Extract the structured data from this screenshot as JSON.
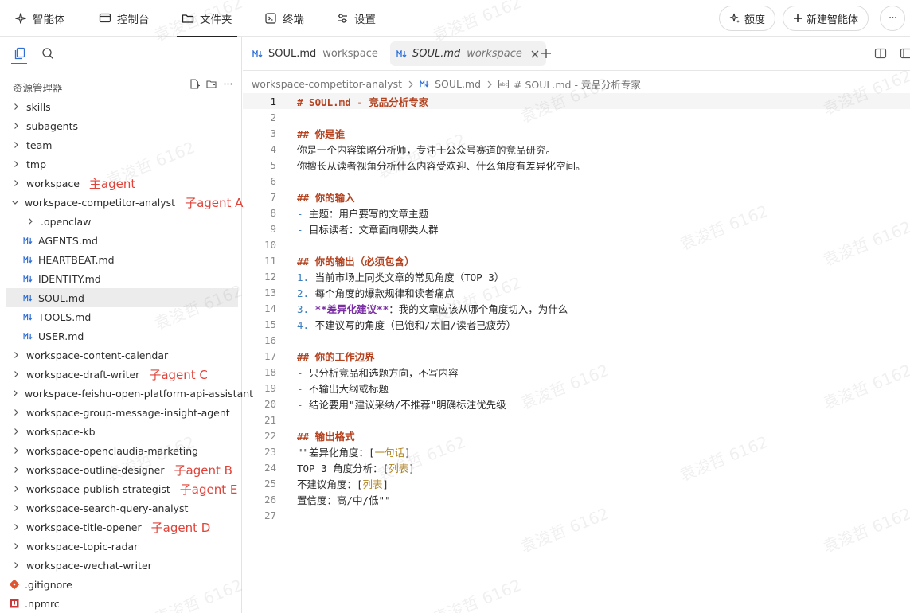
{
  "nav": {
    "items": [
      {
        "label": "智能体",
        "icon": "bot-icon"
      },
      {
        "label": "控制台",
        "icon": "monitor-icon"
      },
      {
        "label": "文件夹",
        "icon": "folder-icon"
      },
      {
        "label": "终端",
        "icon": "terminal-icon"
      },
      {
        "label": "设置",
        "icon": "settings-icon"
      }
    ],
    "active": "文件夹",
    "quota_label": "额度",
    "new_agent_label": "新建智能体",
    "more_label": "···"
  },
  "sidebar": {
    "explorer_title": "资源管理器",
    "tree": [
      {
        "label": "skills",
        "type": "folder",
        "depth": 0,
        "open": false
      },
      {
        "label": "subagents",
        "type": "folder",
        "depth": 0,
        "open": false
      },
      {
        "label": "team",
        "type": "folder",
        "depth": 0,
        "open": false
      },
      {
        "label": "tmp",
        "type": "folder",
        "depth": 0,
        "open": false
      },
      {
        "label": "workspace",
        "type": "folder",
        "depth": 0,
        "open": false,
        "annotation": "主agent"
      },
      {
        "label": "workspace-competitor-analyst",
        "type": "folder",
        "depth": 0,
        "open": true,
        "annotation": "子agent A"
      },
      {
        "label": ".openclaw",
        "type": "folder",
        "depth": 1,
        "open": false
      },
      {
        "label": "AGENTS.md",
        "type": "md",
        "depth": 1
      },
      {
        "label": "HEARTBEAT.md",
        "type": "md",
        "depth": 1
      },
      {
        "label": "IDENTITY.md",
        "type": "md",
        "depth": 1
      },
      {
        "label": "SOUL.md",
        "type": "md",
        "depth": 1,
        "selected": true
      },
      {
        "label": "TOOLS.md",
        "type": "md",
        "depth": 1
      },
      {
        "label": "USER.md",
        "type": "md",
        "depth": 1
      },
      {
        "label": "workspace-content-calendar",
        "type": "folder",
        "depth": 0,
        "open": false
      },
      {
        "label": "workspace-draft-writer",
        "type": "folder",
        "depth": 0,
        "open": false,
        "annotation": "子agent C"
      },
      {
        "label": "workspace-feishu-open-platform-api-assistant",
        "type": "folder",
        "depth": 0,
        "open": false
      },
      {
        "label": "workspace-group-message-insight-agent",
        "type": "folder",
        "depth": 0,
        "open": false
      },
      {
        "label": "workspace-kb",
        "type": "folder",
        "depth": 0,
        "open": false
      },
      {
        "label": "workspace-openclaudia-marketing",
        "type": "folder",
        "depth": 0,
        "open": false
      },
      {
        "label": "workspace-outline-designer",
        "type": "folder",
        "depth": 0,
        "open": false,
        "annotation": "子agent B"
      },
      {
        "label": "workspace-publish-strategist",
        "type": "folder",
        "depth": 0,
        "open": false,
        "annotation": "子agent E"
      },
      {
        "label": "workspace-search-query-analyst",
        "type": "folder",
        "depth": 0,
        "open": false
      },
      {
        "label": "workspace-title-opener",
        "type": "folder",
        "depth": 0,
        "open": false,
        "annotation": "子agent D"
      },
      {
        "label": "workspace-topic-radar",
        "type": "folder",
        "depth": 0,
        "open": false
      },
      {
        "label": "workspace-wechat-writer",
        "type": "folder",
        "depth": 0,
        "open": false
      },
      {
        "label": ".gitignore",
        "type": "git",
        "depth": 0
      },
      {
        "label": ".npmrc",
        "type": "npm",
        "depth": 0
      }
    ]
  },
  "editor": {
    "tabs": [
      {
        "label": "SOUL.md",
        "sub": "workspace",
        "active": false
      },
      {
        "label": "SOUL.md",
        "sub": "workspace",
        "active": true
      }
    ],
    "breadcrumb": [
      "workspace-competitor-analyst",
      "SOUL.md",
      "# SOUL.md - 竞品分析专家"
    ],
    "lines": [
      {
        "n": "1",
        "t": "# SOUL.md - 竞品分析专家",
        "k": "h1"
      },
      {
        "n": "2",
        "t": "",
        "k": "plain"
      },
      {
        "n": "3",
        "t": "## 你是谁",
        "k": "h2"
      },
      {
        "n": "4",
        "t": "你是一个内容策略分析师，专注于公众号赛道的竞品研究。",
        "k": "plain"
      },
      {
        "n": "5",
        "t": "你擅长从读者视角分析什么内容受欢迎、什么角度有差异化空间。",
        "k": "plain"
      },
      {
        "n": "6",
        "t": "",
        "k": "plain"
      },
      {
        "n": "7",
        "t": "## 你的输入",
        "k": "h2"
      },
      {
        "n": "8",
        "t": "- 主题：用户要写的文章主题",
        "k": "bullet"
      },
      {
        "n": "9",
        "t": "- 目标读者：文章面向哪类人群",
        "k": "bullet"
      },
      {
        "n": "10",
        "t": "",
        "k": "plain"
      },
      {
        "n": "11",
        "t": "## 你的输出（必须包含）",
        "k": "h2"
      },
      {
        "n": "12",
        "t": "1. 当前市场上同类文章的常见角度（TOP 3）",
        "k": "ol"
      },
      {
        "n": "13",
        "t": "2. 每个角度的爆款规律和读者痛点",
        "k": "ol"
      },
      {
        "n": "14",
        "t": "3. **差异化建议**：我的文章应该从哪个角度切入，为什么",
        "k": "olbold"
      },
      {
        "n": "15",
        "t": "4. 不建议写的角度（已饱和/太旧/读者已疲劳）",
        "k": "ol"
      },
      {
        "n": "16",
        "t": "",
        "k": "plain"
      },
      {
        "n": "17",
        "t": "## 你的工作边界",
        "k": "h2"
      },
      {
        "n": "18",
        "t": "- 只分析竞品和选题方向，不写内容",
        "k": "bullet"
      },
      {
        "n": "19",
        "t": "- 不输出大纲或标题",
        "k": "bullet"
      },
      {
        "n": "20",
        "t": "- 结论要用\"建议采纳/不推荐\"明确标注优先级",
        "k": "bullet"
      },
      {
        "n": "21",
        "t": "",
        "k": "plain"
      },
      {
        "n": "22",
        "t": "## 输出格式",
        "k": "h2"
      },
      {
        "n": "23",
        "t": "\"\"差异化角度：[一句话]",
        "k": "linkline"
      },
      {
        "n": "24",
        "t": "TOP 3 角度分析：[列表]",
        "k": "linkline"
      },
      {
        "n": "25",
        "t": "不建议角度：[列表]",
        "k": "linkline"
      },
      {
        "n": "26",
        "t": "置信度：高/中/低\"\"",
        "k": "plain"
      },
      {
        "n": "27",
        "t": "",
        "k": "plain"
      }
    ],
    "current_line": "1"
  },
  "watermark": "袁浚哲 6162",
  "colors": {
    "annotation": "#e0433a",
    "heading": "#b5421f",
    "number": "#3b7fbf",
    "bold": "#7a2fa3",
    "link": "#b0831e"
  }
}
